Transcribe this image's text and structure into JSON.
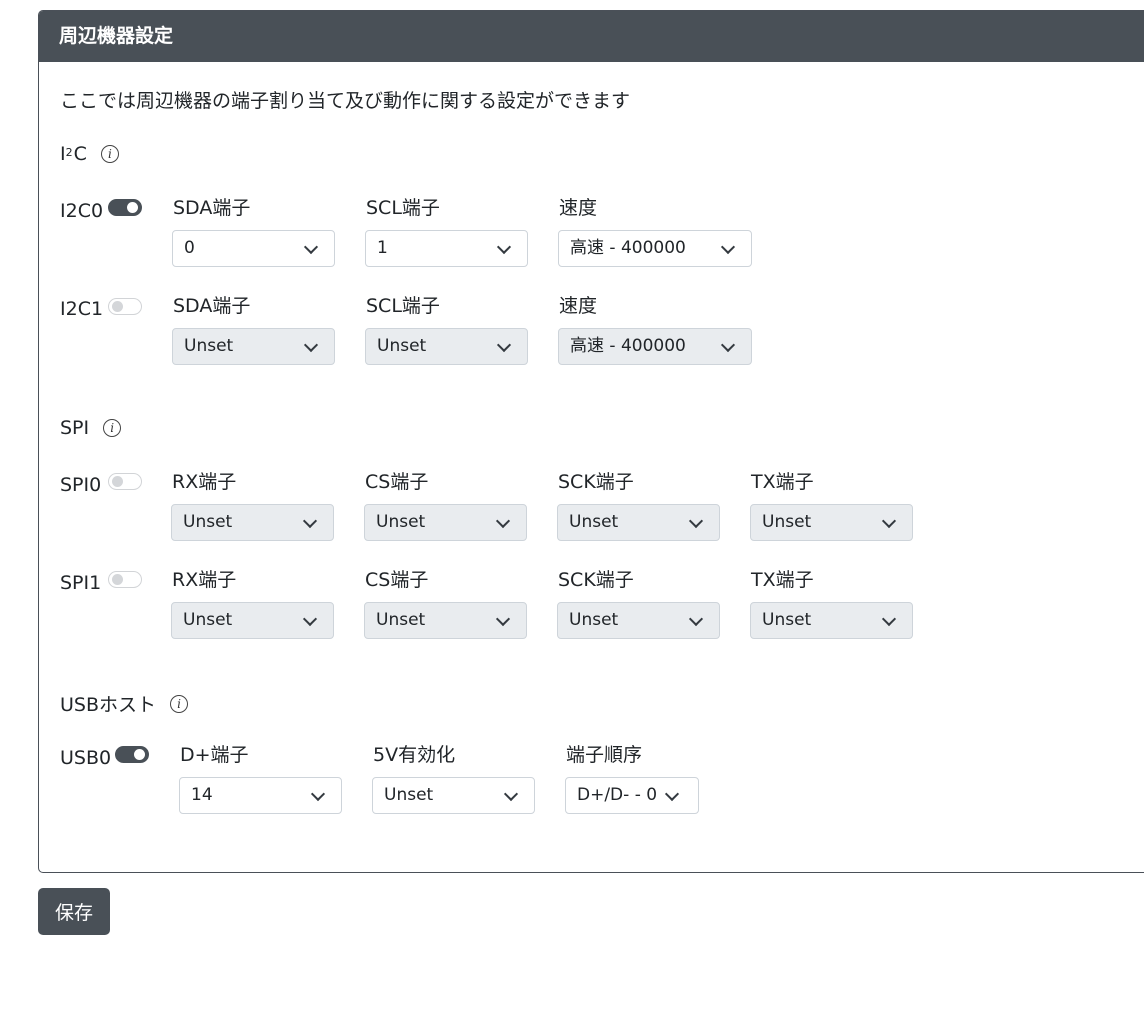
{
  "panel": {
    "title": "周辺機器設定",
    "description": "ここでは周辺機器の端子割り当て及び動作に関する設定ができます"
  },
  "i2c": {
    "title_prefix": "I",
    "title_sup": "2",
    "title_suffix": "C",
    "devices": [
      {
        "name": "I2C0",
        "enabled": true,
        "fields": [
          {
            "label": "SDA端子",
            "value": "0"
          },
          {
            "label": "SCL端子",
            "value": "1"
          },
          {
            "label": "速度",
            "value": "高速 - 400000"
          }
        ]
      },
      {
        "name": "I2C1",
        "enabled": false,
        "fields": [
          {
            "label": "SDA端子",
            "value": "Unset"
          },
          {
            "label": "SCL端子",
            "value": "Unset"
          },
          {
            "label": "速度",
            "value": "高速 - 400000"
          }
        ]
      }
    ]
  },
  "spi": {
    "title": "SPI",
    "devices": [
      {
        "name": "SPI0",
        "enabled": false,
        "fields": [
          {
            "label": "RX端子",
            "value": "Unset"
          },
          {
            "label": "CS端子",
            "value": "Unset"
          },
          {
            "label": "SCK端子",
            "value": "Unset"
          },
          {
            "label": "TX端子",
            "value": "Unset"
          }
        ]
      },
      {
        "name": "SPI1",
        "enabled": false,
        "fields": [
          {
            "label": "RX端子",
            "value": "Unset"
          },
          {
            "label": "CS端子",
            "value": "Unset"
          },
          {
            "label": "SCK端子",
            "value": "Unset"
          },
          {
            "label": "TX端子",
            "value": "Unset"
          }
        ]
      }
    ]
  },
  "usb": {
    "title": "USBホスト",
    "devices": [
      {
        "name": "USB0",
        "enabled": true,
        "fields": [
          {
            "label": "D+端子",
            "value": "14"
          },
          {
            "label": "5V有効化",
            "value": "Unset"
          },
          {
            "label": "端子順序",
            "value": "D+/D- - 0"
          }
        ]
      }
    ]
  },
  "actions": {
    "save_label": "保存"
  },
  "icons": {
    "info": "info-icon",
    "dropdown": "chevron-down-icon"
  },
  "colors": {
    "header_bg": "#495057",
    "button_bg": "#495057",
    "disabled_bg": "#e9ecef"
  }
}
